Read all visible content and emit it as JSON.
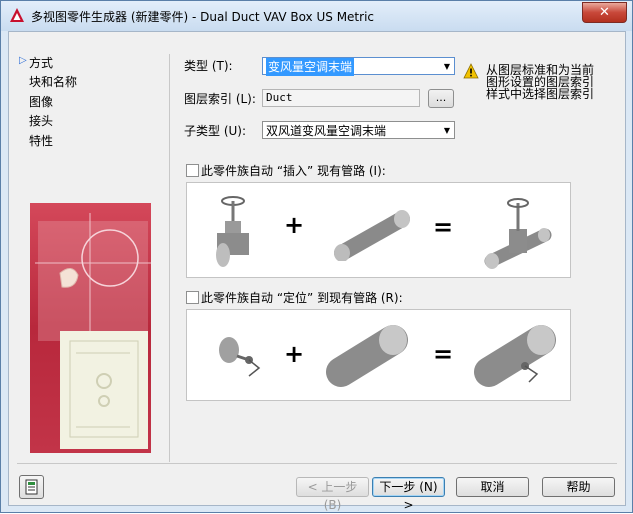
{
  "window": {
    "title": "多视图零件生成器 (新建零件) - Dual Duct VAV Box US Metric",
    "close_label": "✕"
  },
  "nav": {
    "items": [
      "方式",
      "块和名称",
      "图像",
      "接头",
      "特性"
    ]
  },
  "form": {
    "type_label": "类型 (T):",
    "type_value": "变风量空调末端",
    "layer_key_label": "图层索引 (L):",
    "layer_key_value": "Duct",
    "browse_label": "...",
    "subtype_label": "子类型 (U):",
    "subtype_value": "双风道变风量空调末端",
    "info_text": "从图层标准和为当前图形设置的图层索引样式中选择图层索引",
    "insert_checkbox_label": "此零件族自动 “插入” 现有管路 (I):",
    "insert_checked": false,
    "locate_checkbox_label": "此零件族自动 “定位” 到现有管路 (R):",
    "locate_checked": false
  },
  "symbols": {
    "plus": "+",
    "equals": "="
  },
  "footer": {
    "back_label": "< 上一步 (B)",
    "next_label": "下一步 (N) >",
    "cancel_label": "取消",
    "help_label": "帮助"
  },
  "colors": {
    "accent": "#2f6fd6",
    "art_red": "#c6263d",
    "warning": "#f2c200"
  }
}
